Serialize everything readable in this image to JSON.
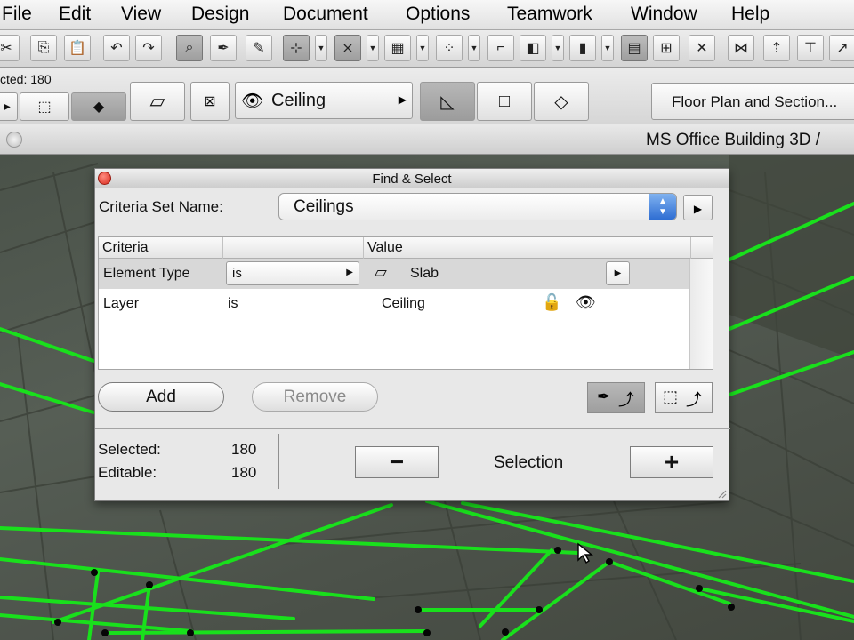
{
  "menubar": {
    "items": [
      "File",
      "Edit",
      "View",
      "Design",
      "Document",
      "Options",
      "Teamwork",
      "Window",
      "Help"
    ]
  },
  "infobox": {
    "selected_text": "cted: 180",
    "layer_value": "Ceiling",
    "view_button": "Floor Plan and Section..."
  },
  "document": {
    "title": "MS Office Building 3D /"
  },
  "find_select": {
    "title": "Find & Select",
    "criteria_set_label": "Criteria Set Name:",
    "criteria_set_value": "Ceilings",
    "columns": [
      "Criteria",
      "",
      "Value"
    ],
    "rows": [
      {
        "criteria": "Element Type",
        "operator": "is",
        "value": "Slab"
      },
      {
        "criteria": "Layer",
        "operator": "is",
        "value": "Ceiling"
      }
    ],
    "add_label": "Add",
    "remove_label": "Remove",
    "selected_label": "Selected:",
    "selected_value": "180",
    "editable_label": "Editable:",
    "editable_value": "180",
    "selection_label": "Selection",
    "minus_label": "−",
    "plus_label": "+"
  },
  "colors": {
    "selection_green": "#19e01c",
    "close_red": "#d8281b",
    "stepper_blue": "#2f6ed3"
  }
}
